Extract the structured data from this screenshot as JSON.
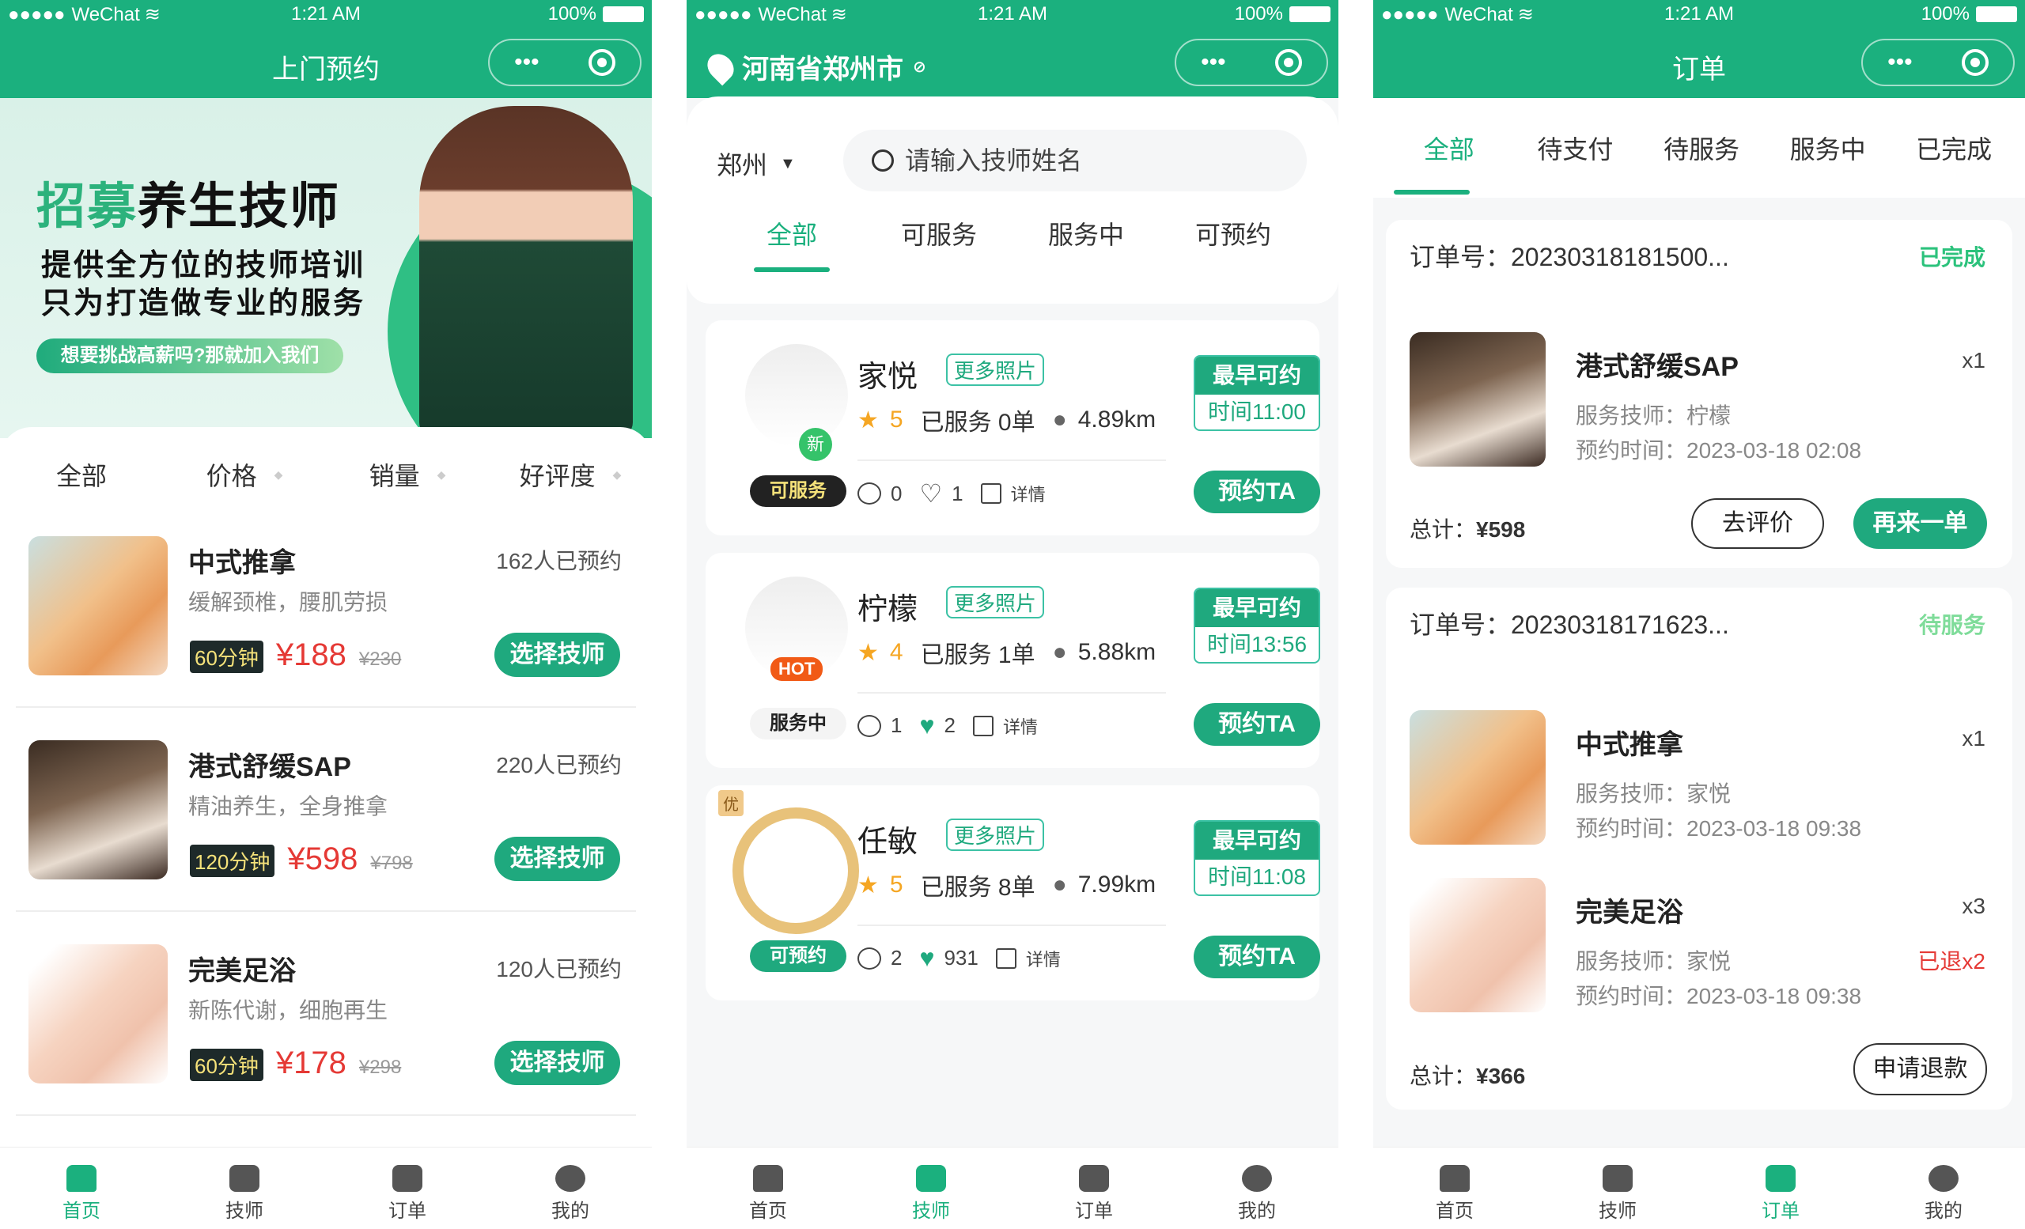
{
  "status_bar": {
    "signal": "●●●●●",
    "carrier": "WeChat",
    "time": "1:21 AM",
    "battery": "100%"
  },
  "capsule": {
    "more": "•••"
  },
  "colors": {
    "brand_green": "#1bb07e",
    "price_red": "#e53935",
    "star": "#f5a623"
  },
  "home": {
    "title": "上门预约",
    "banner": {
      "headline_green": "招募",
      "headline_black": "养生技师",
      "line1": "提供全方位的技师培训",
      "line2": "只为打造做专业的服务",
      "cta": "想要挑战高薪吗?那就加入我们"
    },
    "sort": [
      "全部",
      "价格",
      "销量",
      "好评度"
    ],
    "services": [
      {
        "name": "中式推拿",
        "desc": "缓解颈椎，腰肌劳损",
        "booked": "162人已预约",
        "duration": "60分钟",
        "price": "¥188",
        "orig": "¥230",
        "button": "选择技师"
      },
      {
        "name": "港式舒缓SAP",
        "desc": "精油养生，全身推拿",
        "booked": "220人已预约",
        "duration": "120分钟",
        "price": "¥598",
        "orig": "¥798",
        "button": "选择技师"
      },
      {
        "name": "完美足浴",
        "desc": "新陈代谢，细胞再生",
        "booked": "120人已预约",
        "duration": "60分钟",
        "price": "¥178",
        "orig": "¥298",
        "button": "选择技师"
      }
    ]
  },
  "technicians": {
    "location": "河南省郑州市",
    "city": "郑州",
    "search_placeholder": "请输入技师姓名",
    "tabs": [
      "全部",
      "可服务",
      "服务中",
      "可预约"
    ],
    "active_tab": 0,
    "list": [
      {
        "name": "家悦",
        "more_photos": "更多照片",
        "rating": "5",
        "served": "已服务 0单",
        "distance": "4.89km",
        "earliest_label": "最早可约",
        "earliest_time": "时间11:00",
        "status": "可服务",
        "badge": "新",
        "comments": "0",
        "likes": "1",
        "liked": false,
        "detail": "详情",
        "book": "预约TA"
      },
      {
        "name": "柠檬",
        "more_photos": "更多照片",
        "rating": "4",
        "served": "已服务 1单",
        "distance": "5.88km",
        "earliest_label": "最早可约",
        "earliest_time": "时间13:56",
        "status": "服务中",
        "badge": "HOT",
        "comments": "1",
        "likes": "2",
        "liked": true,
        "detail": "详情",
        "book": "预约TA"
      },
      {
        "name": "任敏",
        "more_photos": "更多照片",
        "rating": "5",
        "served": "已服务 8单",
        "distance": "7.99km",
        "earliest_label": "最早可约",
        "earliest_time": "时间11:08",
        "status": "可预约",
        "badge": "优",
        "comments": "2",
        "likes": "931",
        "liked": true,
        "detail": "详情",
        "book": "预约TA"
      }
    ]
  },
  "orders": {
    "title": "订单",
    "tabs": [
      "全部",
      "待支付",
      "待服务",
      "服务中",
      "已完成"
    ],
    "active_tab": 0,
    "list": [
      {
        "no": "订单号：20230318181500...",
        "status": "已完成",
        "items": [
          {
            "name": "港式舒缓SAP",
            "qty": "x1",
            "tech": "服务技师：柠檬",
            "time": "预约时间：2023-03-18 02:08",
            "refund": ""
          }
        ],
        "total_label": "总计：",
        "total": "¥598",
        "buttons": [
          "去评价",
          "再来一单"
        ]
      },
      {
        "no": "订单号：20230318171623...",
        "status": "待服务",
        "items": [
          {
            "name": "中式推拿",
            "qty": "x1",
            "tech": "服务技师：家悦",
            "time": "预约时间：2023-03-18 09:38",
            "refund": ""
          },
          {
            "name": "完美足浴",
            "qty": "x3",
            "tech": "服务技师：家悦",
            "time": "预约时间：2023-03-18 09:38",
            "refund": "已退x2"
          }
        ],
        "total_label": "总计：",
        "total": "¥366",
        "buttons": [
          "申请退款"
        ]
      }
    ]
  },
  "tabbar": [
    {
      "label": "首页",
      "icon": "home-icon"
    },
    {
      "label": "技师",
      "icon": "heart-icon"
    },
    {
      "label": "订单",
      "icon": "calendar-icon"
    },
    {
      "label": "我的",
      "icon": "user-icon"
    }
  ]
}
